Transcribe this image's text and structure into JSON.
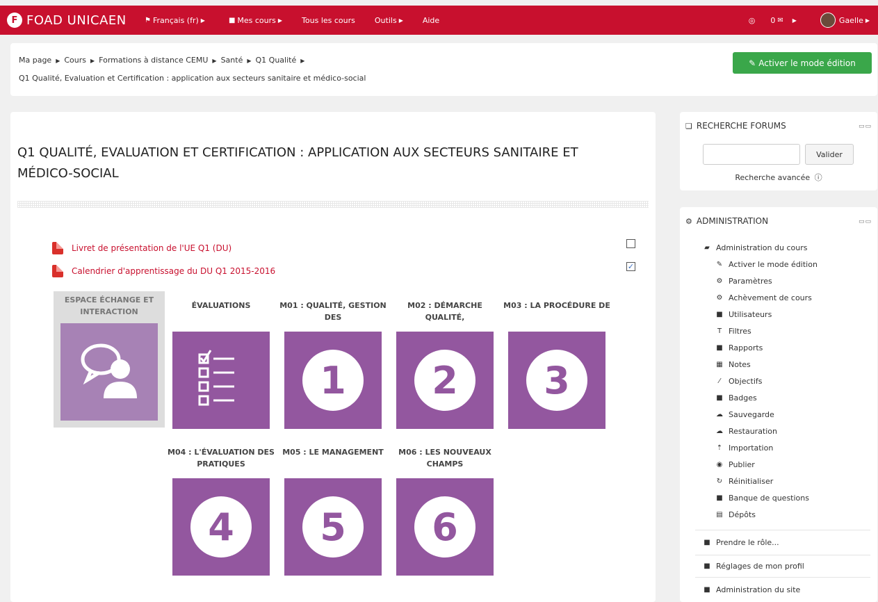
{
  "navbar": {
    "brand_logo": "F",
    "brand": "FOAD UNICAEN",
    "items": [
      {
        "label": "Français (fr)",
        "icon": "flag-icon",
        "glyph": "⚑"
      },
      {
        "label": "Mes cours",
        "icon": "briefcase-icon",
        "glyph": "■"
      },
      {
        "label": "Tous les cours"
      },
      {
        "label": "Outils"
      },
      {
        "label": "Aide"
      }
    ],
    "messages": "0",
    "user": "Gaelle",
    "accent": "#c8102e"
  },
  "breadcrumb": {
    "items": [
      "Ma page",
      "Cours",
      "Formations à distance CEMU",
      "Santé",
      "Q1 Qualité"
    ],
    "last": "Q1 Qualité, Evaluation et Certification : application aux secteurs sanitaire et médico-social"
  },
  "edit_button": "Activer le mode édition",
  "course": {
    "title": "Q1 QUALITÉ, EVALUATION ET CERTIFICATION : APPLICATION AUX SECTEURS SANITAIRE ET MÉDICO-SOCIAL",
    "resources": [
      {
        "label": "Livret de présentation de l'UE Q1 (DU)",
        "checked": false
      },
      {
        "label": "Calendrier d'apprentissage du DU Q1 2015-2016",
        "checked": true
      }
    ],
    "tiles": [
      {
        "label": "ESPACE ÉCHANGE ET INTERACTION",
        "icon": "chat-user-icon"
      },
      {
        "label": "ÉVALUATIONS",
        "icon": "checklist-icon"
      },
      {
        "label": "M01 : QUALITÉ, GESTION DES",
        "number": "1"
      },
      {
        "label": "M02 : DÉMARCHE QUALITÉ,",
        "number": "2"
      },
      {
        "label": "M03 : LA PROCÉDURE DE",
        "number": "3"
      },
      {
        "label": "M04 : L'ÉVALUATION DES PRATIQUES",
        "number": "4"
      },
      {
        "label": "M05 : LE MANAGEMENT",
        "number": "5"
      },
      {
        "label": "M06 : LES NOUVEAUX CHAMPS",
        "number": "6"
      }
    ],
    "tile_color": "#93579f"
  },
  "search_block": {
    "title": "RECHERCHE FORUMS",
    "button": "Valider",
    "advanced": "Recherche avancée"
  },
  "admin_block": {
    "title": "ADMINISTRATION",
    "root": "Administration du cours",
    "items": [
      {
        "label": "Activer le mode édition",
        "icon": "pencil-icon",
        "glyph": "✎"
      },
      {
        "label": "Paramètres",
        "icon": "gears-icon",
        "glyph": "⚙"
      },
      {
        "label": "Achèvement de cours",
        "icon": "gears-icon",
        "glyph": "⚙"
      },
      {
        "label": "Utilisateurs",
        "icon": "folder-icon",
        "glyph": "■"
      },
      {
        "label": "Filtres",
        "icon": "filter-icon",
        "glyph": "T"
      },
      {
        "label": "Rapports",
        "icon": "folder-icon",
        "glyph": "■"
      },
      {
        "label": "Notes",
        "icon": "grid-icon",
        "glyph": "▦"
      },
      {
        "label": "Objectifs",
        "icon": "magic-wand-icon",
        "glyph": "⁄"
      },
      {
        "label": "Badges",
        "icon": "folder-icon",
        "glyph": "■"
      },
      {
        "label": "Sauvegarde",
        "icon": "cloud-upload-icon",
        "glyph": "☁"
      },
      {
        "label": "Restauration",
        "icon": "cloud-download-icon",
        "glyph": "☁"
      },
      {
        "label": "Importation",
        "icon": "upload-icon",
        "glyph": "⇡"
      },
      {
        "label": "Publier",
        "icon": "globe-icon",
        "glyph": "◉"
      },
      {
        "label": "Réinitialiser",
        "icon": "refresh-icon",
        "glyph": "↻"
      },
      {
        "label": "Banque de questions",
        "icon": "folder-icon",
        "glyph": "■"
      },
      {
        "label": "Dépôts",
        "icon": "database-icon",
        "glyph": "▤"
      }
    ],
    "extra": [
      "Prendre le rôle...",
      "Réglages de mon profil",
      "Administration du site"
    ]
  }
}
